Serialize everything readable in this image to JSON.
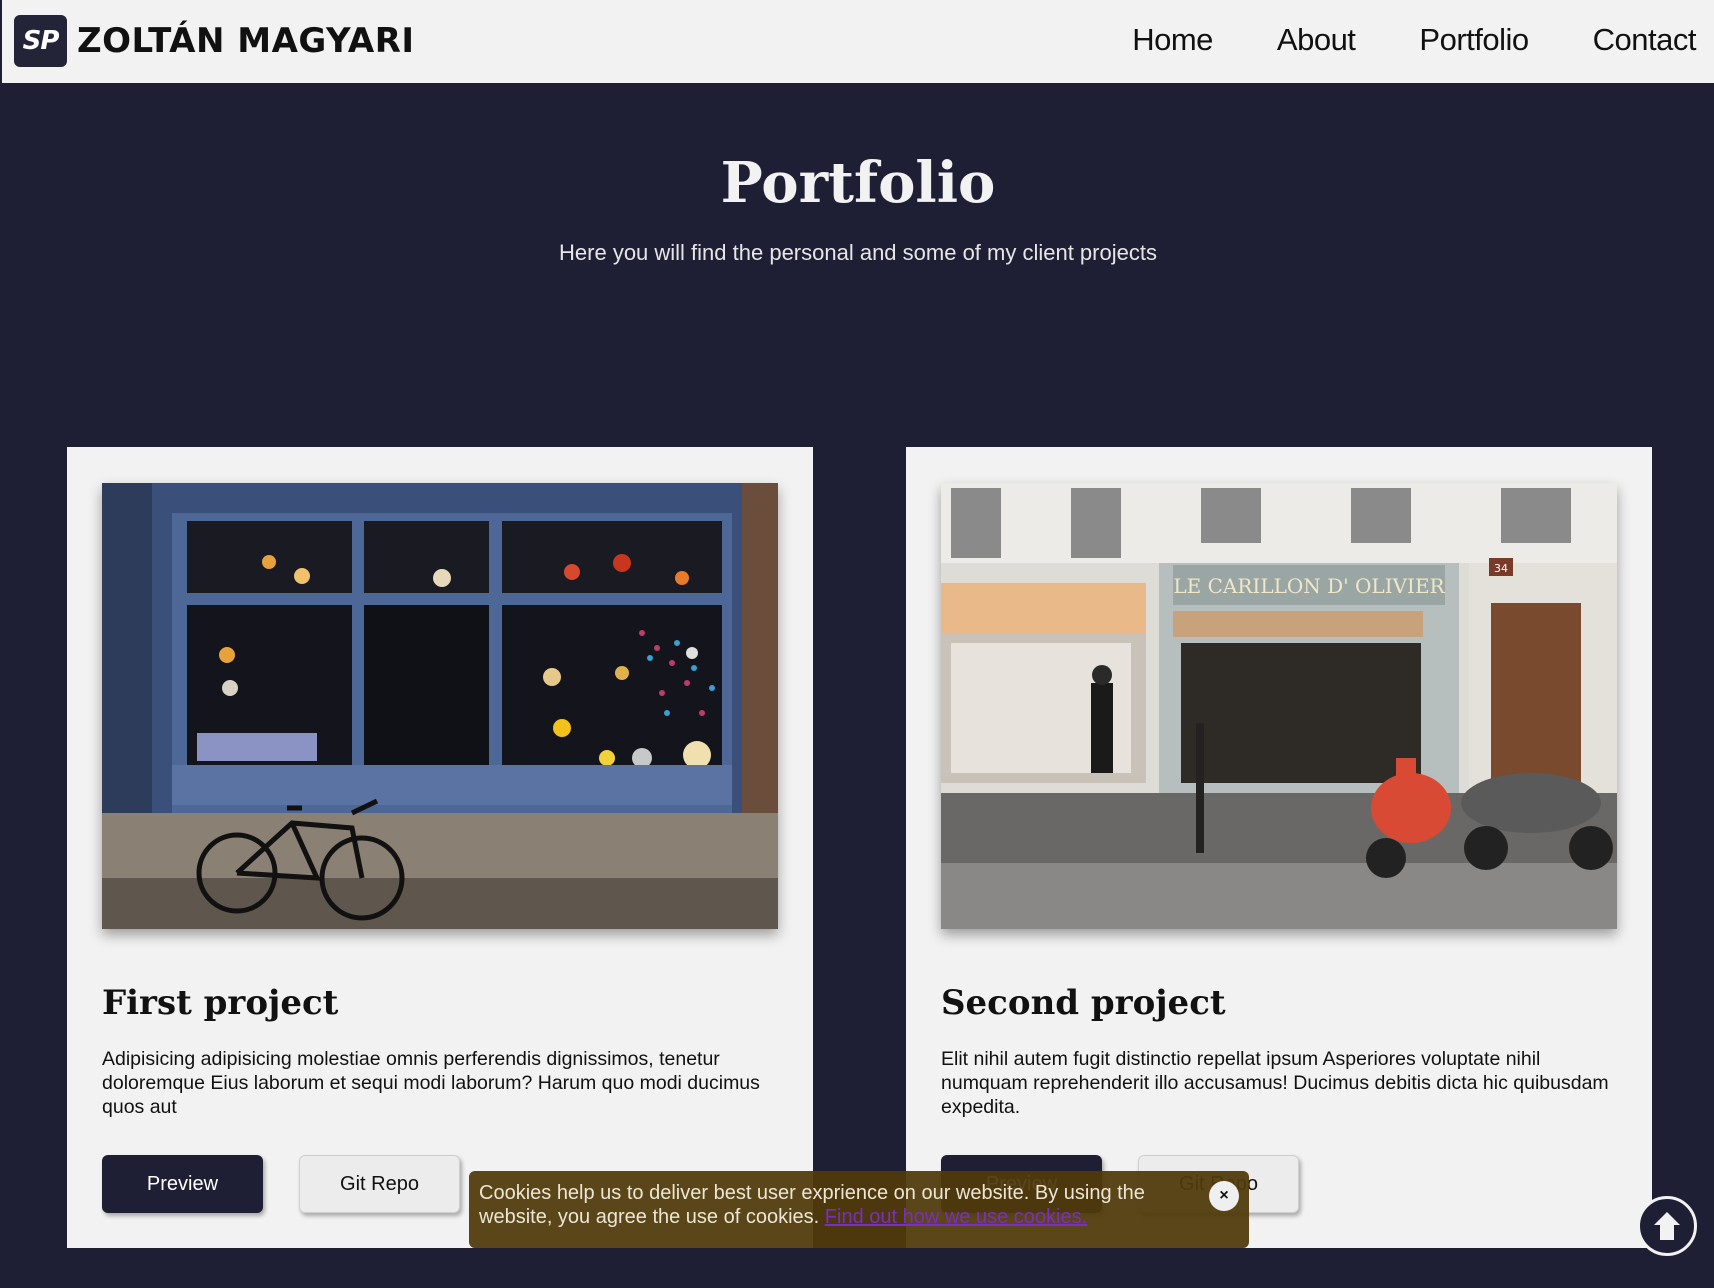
{
  "header": {
    "logo_text": "SP",
    "brand_name": "ZOLTÁN MAGYARI",
    "nav": [
      {
        "label": "Home"
      },
      {
        "label": "About"
      },
      {
        "label": "Portfolio"
      },
      {
        "label": "Contact"
      }
    ]
  },
  "hero": {
    "title": "Portfolio",
    "subtitle": "Here you will find the personal and some of my client projects"
  },
  "projects": [
    {
      "title": "First project",
      "description": "Adipisicing adipisicing molestiae omnis perferendis dignissimos, tenetur doloremque Eius laborum et sequi modi laborum? Harum quo modi ducimus quos aut",
      "preview_label": "Preview",
      "repo_label": "Git Repo",
      "image": "blue-storefront-with-bicycle-photo"
    },
    {
      "title": "Second project",
      "description": "Elit nihil autem fugit distinctio repellat ipsum Asperiores voluptate nihil numquam reprehenderit illo accusamus! Ducimus debitis dicta hic quibusdam expedita.",
      "preview_label": "Preview",
      "repo_label": "Git Repo",
      "image": "street-shops-with-scooters-photo",
      "shop_sign": "LE CARILLON D' OLIVIER",
      "house_number": "34"
    }
  ],
  "cookie": {
    "text": "Cookies help us to deliver best user exprience on our website. By using the website, you agree the use of cookies.",
    "link_label": "Find out how we use cookies.",
    "close_label": "×"
  },
  "colors": {
    "background": "#1e1f35",
    "card": "#f2f2f2",
    "primary_button": "#1e1f35",
    "cookie_bar": "#503a0a",
    "cookie_link": "#7b2fbf"
  },
  "icons": {
    "scroll_top": "arrow-up-icon",
    "cookie_close": "close-icon"
  }
}
